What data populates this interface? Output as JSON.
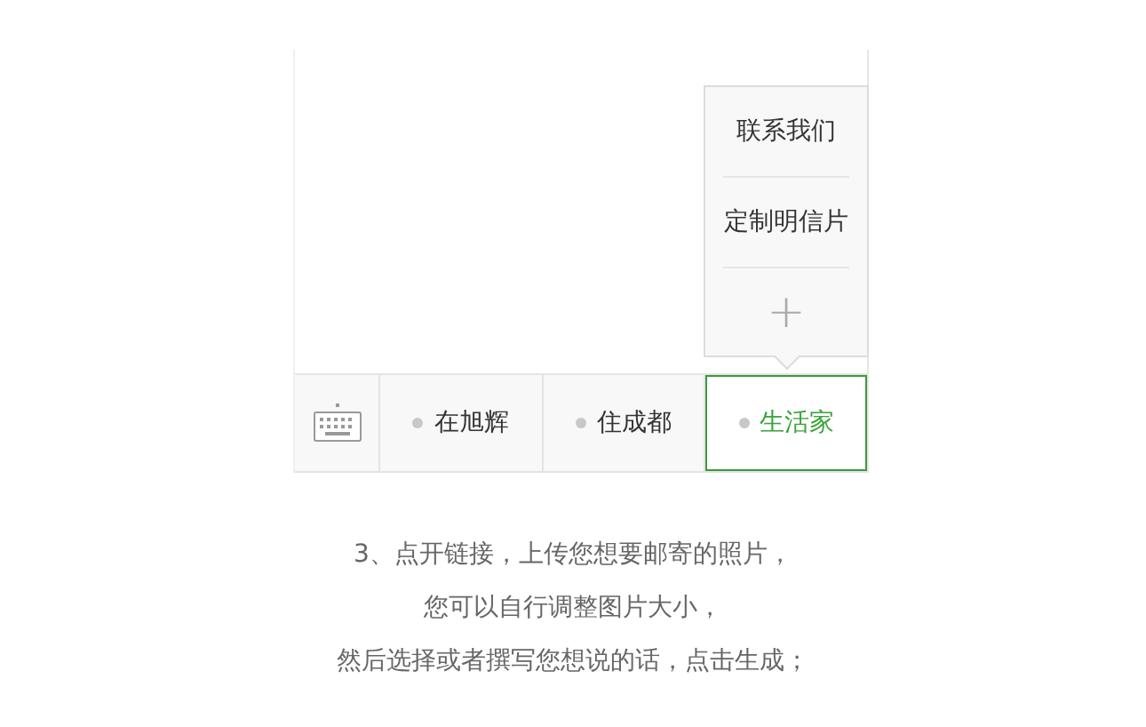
{
  "menu": {
    "items": [
      {
        "label": "在旭辉",
        "selected": false
      },
      {
        "label": "住成都",
        "selected": false
      },
      {
        "label": "生活家",
        "selected": true
      }
    ]
  },
  "submenu": {
    "items": [
      {
        "label": "联系我们",
        "kind": "text"
      },
      {
        "label": "定制明信片",
        "kind": "text"
      },
      {
        "label": "+",
        "kind": "add"
      }
    ]
  },
  "caption": [
    "3、点开链接，上传您想要邮寄的照片，",
    "您可以自行调整图片大小，",
    "然后选择或者撰写您想说的话，点击生成；"
  ]
}
